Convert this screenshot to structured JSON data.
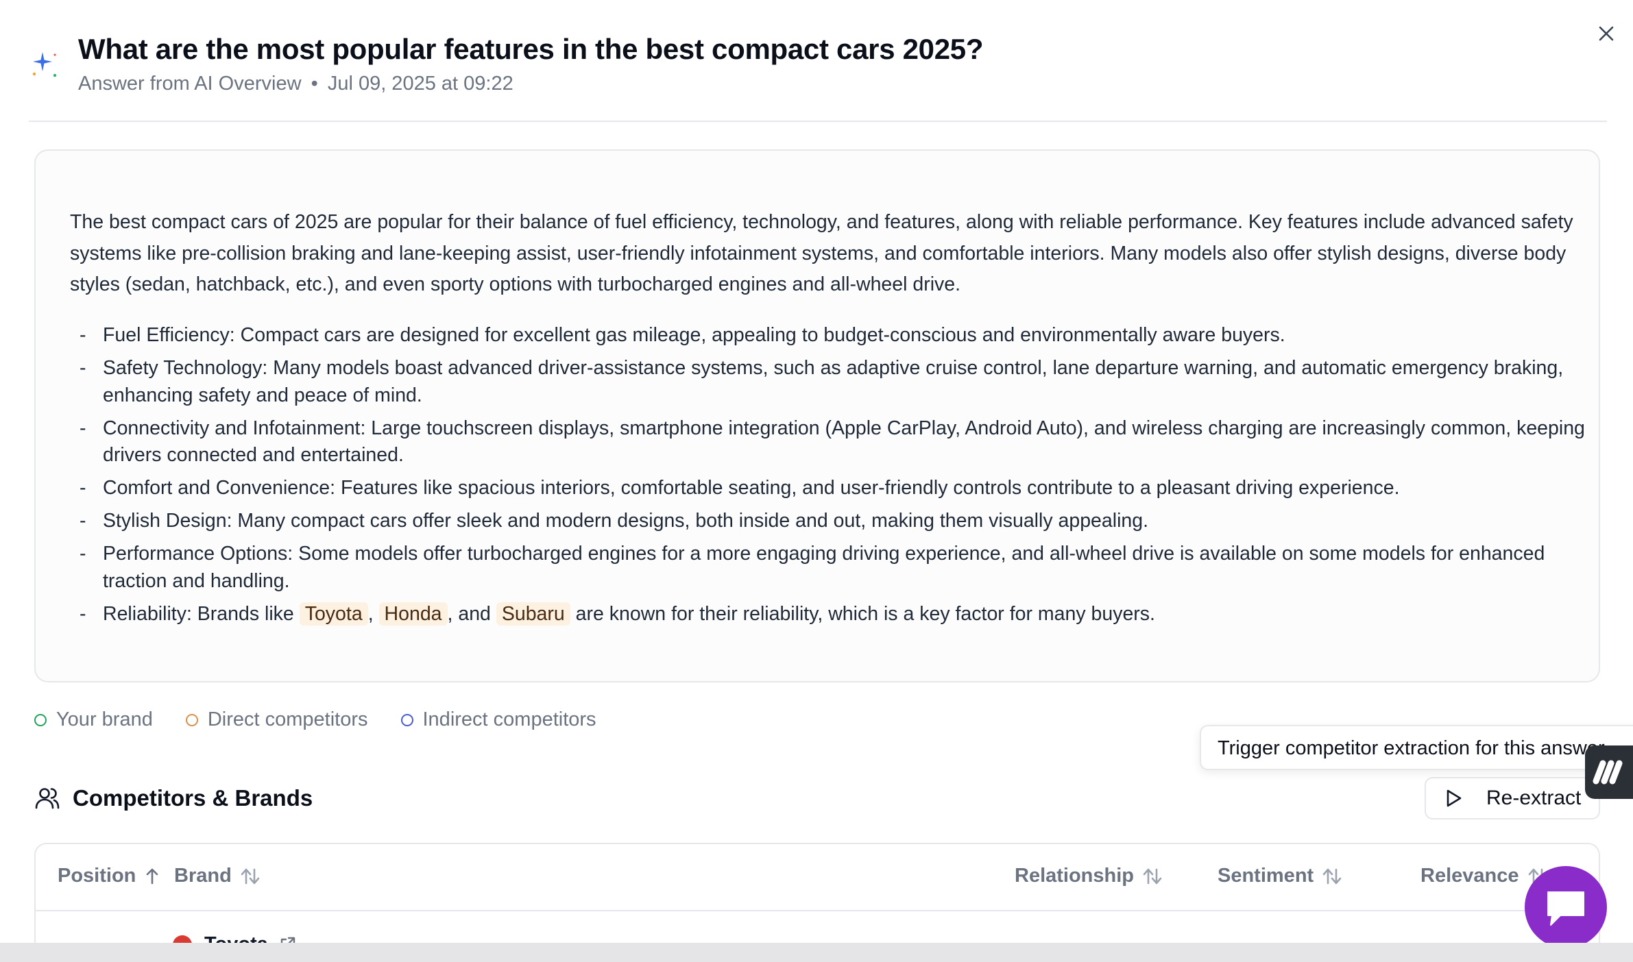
{
  "header": {
    "title": "What are the most popular features in the best compact cars 2025?",
    "source": "Answer from AI Overview",
    "separator": "•",
    "timestamp": "Jul 09, 2025 at 09:22",
    "icon": "sparkle-icon",
    "close_icon": "close-icon"
  },
  "answer": {
    "intro": "The best compact cars of 2025 are popular for their balance of fuel efficiency, technology, and features, along with reliable performance. Key features include advanced safety systems like pre-collision braking and lane-keeping assist, user-friendly infotainment systems, and comfortable interiors. Many models also offer stylish designs, diverse body styles (sedan, hatchback, etc.), and even sporty options with turbocharged engines and all-wheel drive.",
    "items": [
      "Fuel Efficiency: Compact cars are designed for excellent gas mileage, appealing to budget-conscious and environmentally aware buyers.",
      "Safety Technology: Many models boast advanced driver-assistance systems, such as adaptive cruise control, lane departure warning, and automatic emergency braking, enhancing safety and peace of mind.",
      "Connectivity and Infotainment: Large touchscreen displays, smartphone integration (Apple CarPlay, Android Auto), and wireless charging are increasingly common, keeping drivers connected and entertained.",
      "Comfort and Convenience: Features like spacious interiors, comfortable seating, and user-friendly controls contribute to a pleasant driving experience.",
      "Stylish Design: Many compact cars offer sleek and modern designs, both inside and out, making them visually appealing.",
      "Performance Options: Some models offer turbocharged engines for a more engaging driving experience, and all-wheel drive is available on some models for enhanced traction and handling."
    ],
    "reliability": {
      "prefix": "Reliability: Brands like",
      "brand1": "Toyota",
      "sep1": ",",
      "brand2": "Honda",
      "sep2": ", and",
      "brand3": "Subaru",
      "suffix": "are known for their reliability, which is a key factor for many buyers."
    }
  },
  "legend": {
    "your_brand": "Your brand",
    "direct": "Direct competitors",
    "indirect": "Indirect competitors",
    "colors": {
      "your_brand": "#22a35a",
      "direct": "#d9904a",
      "indirect": "#4a5bd1"
    }
  },
  "competitors": {
    "title": "Competitors & Brands",
    "icon": "users-icon",
    "tooltip": "Trigger competitor extraction for this answer",
    "reextract_label": "Re-extract",
    "columns": {
      "position": "Position",
      "brand": "Brand",
      "relationship": "Relationship",
      "sentiment": "Sentiment",
      "relevance": "Relevance"
    },
    "first_row_brand": "Toyota"
  },
  "colors": {
    "chat_fab": "#8a2cc9",
    "highlight_bg": "#fdf1e2",
    "toyota_avatar": "#d93a32"
  }
}
